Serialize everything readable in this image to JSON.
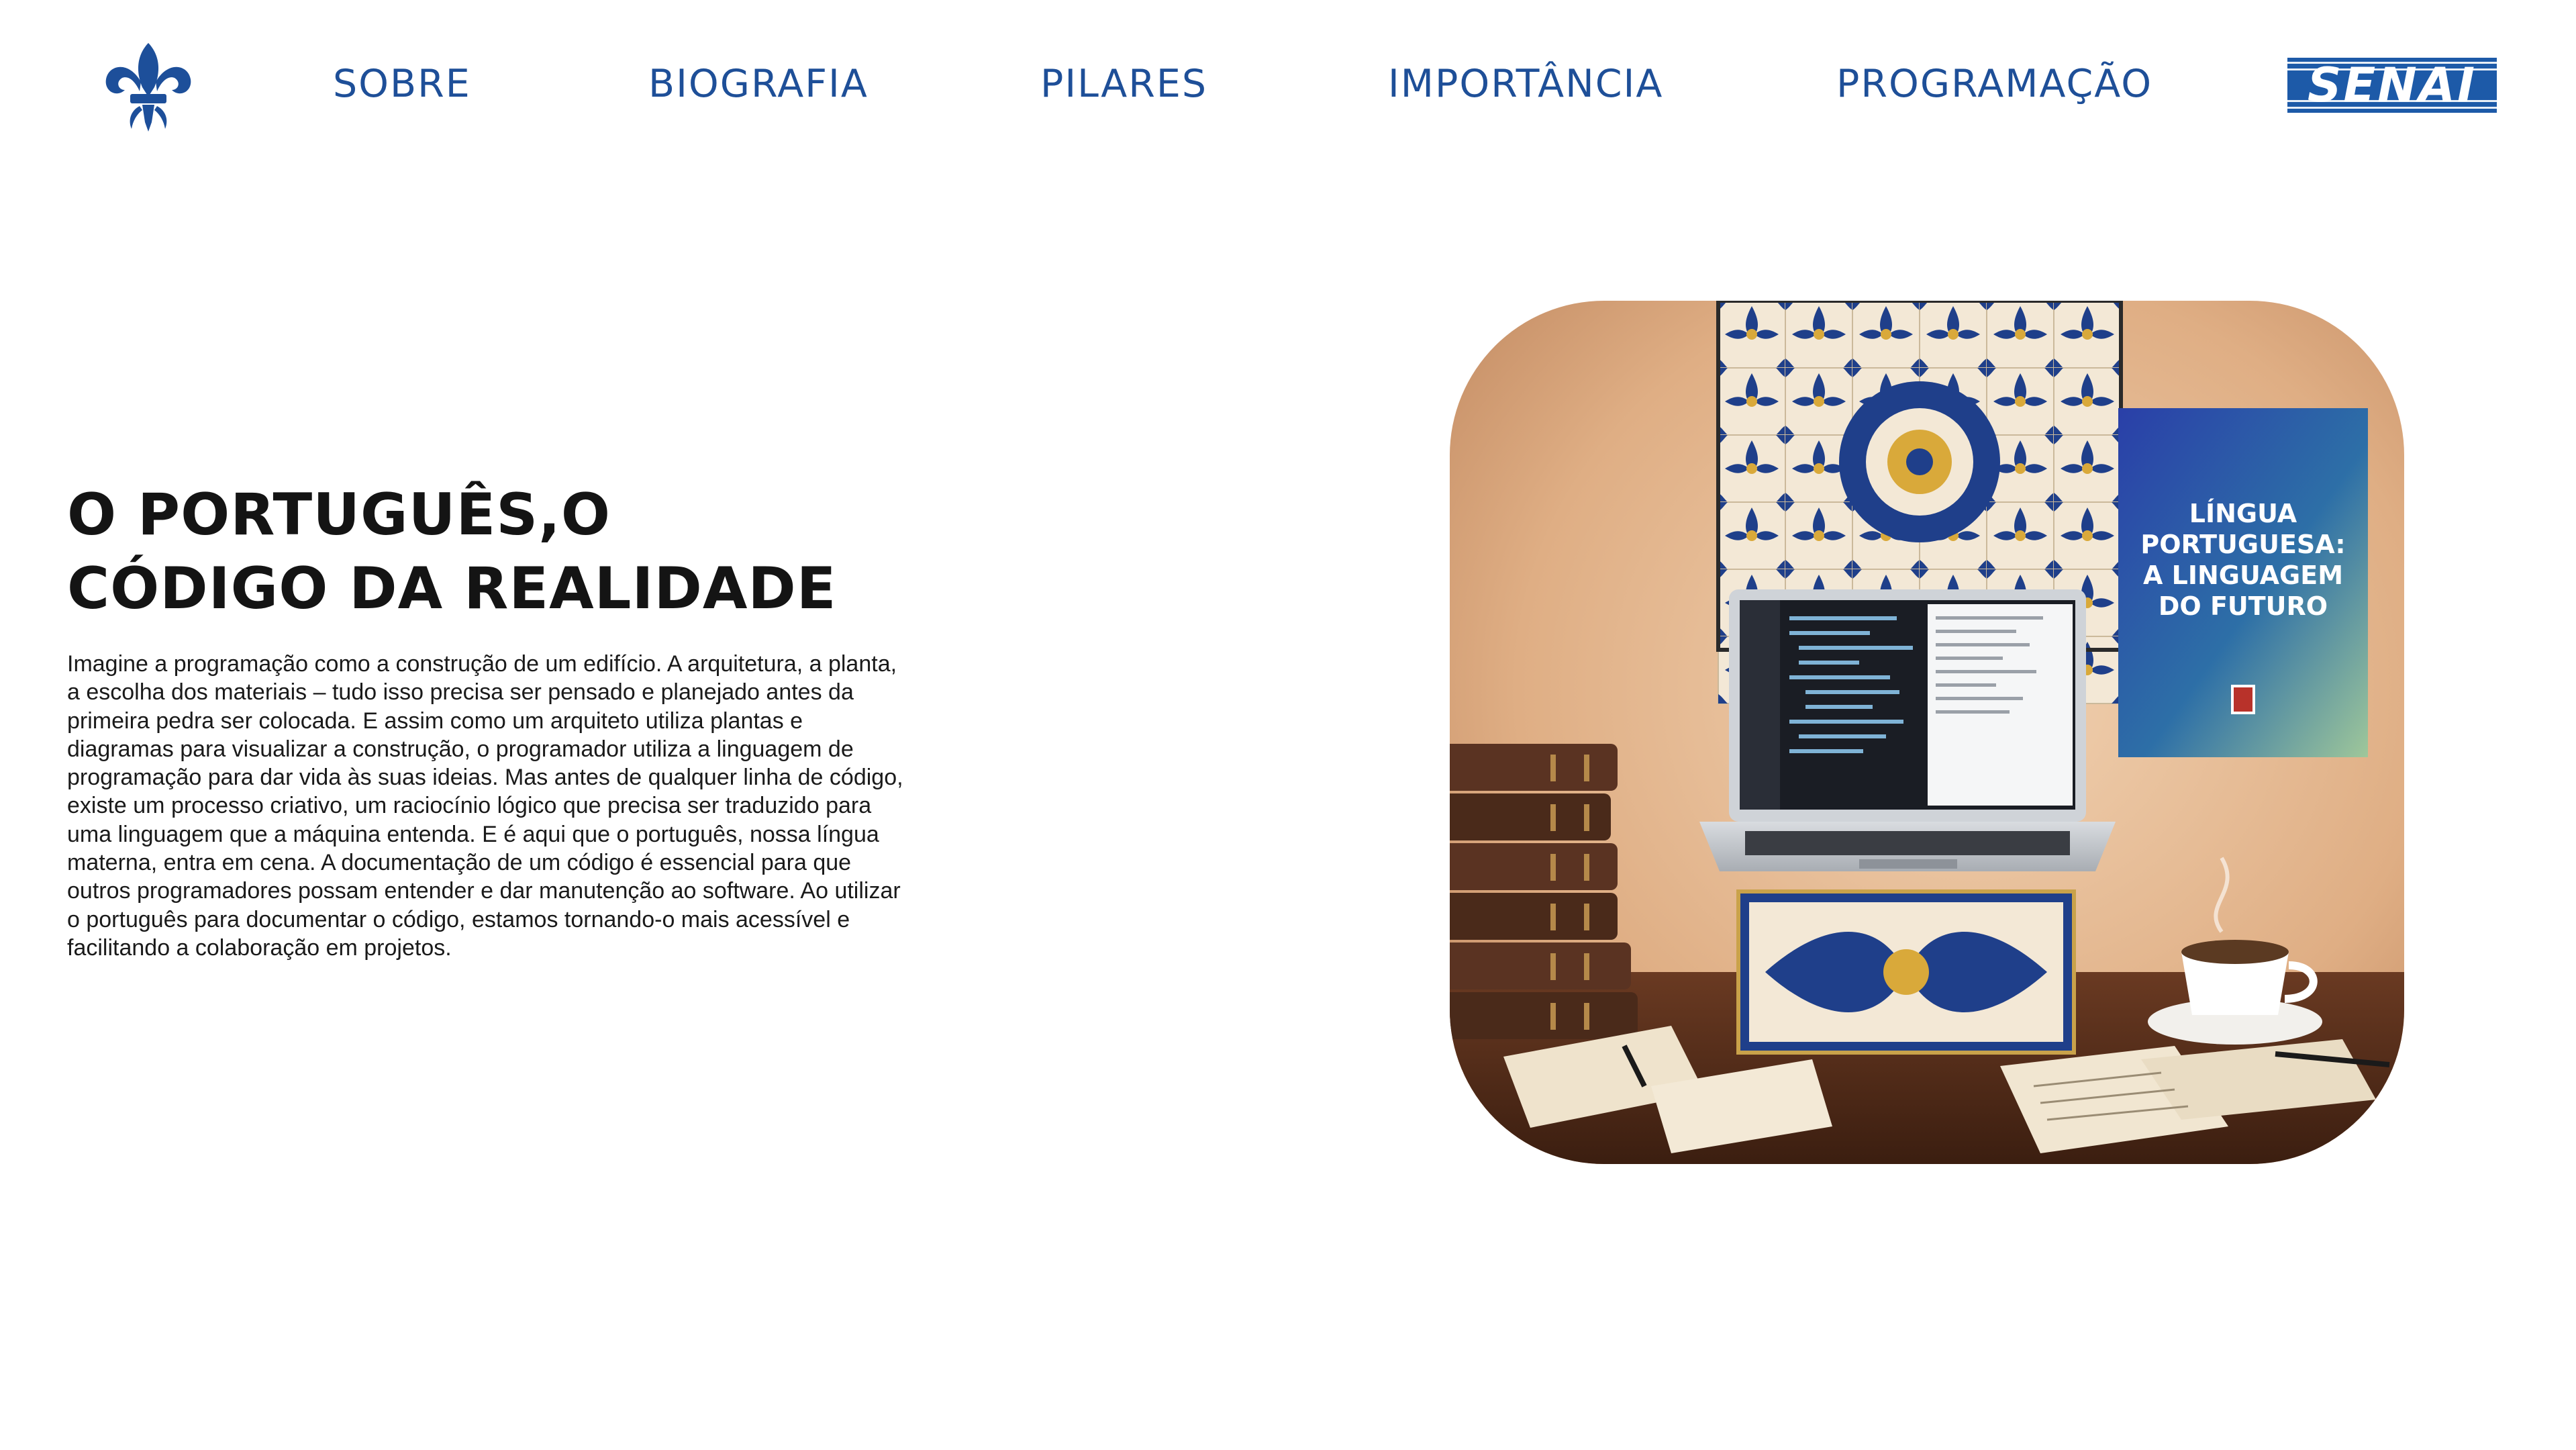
{
  "nav": {
    "items": [
      {
        "label": "SOBRE"
      },
      {
        "label": "BIOGRAFIA"
      },
      {
        "label": "PILARES"
      },
      {
        "label": "IMPORTÂNCIA"
      },
      {
        "label": "PROGRAMAÇÃO"
      }
    ],
    "partner_logo_text": "SENAI"
  },
  "hero": {
    "title_line1": "O PORTUGUÊS,O",
    "title_line2": "CÓDIGO DA REALIDADE",
    "body": "Imagine a programação como a construção de um edifício. A arquitetura, a planta, a escolha dos materiais – tudo isso precisa ser pensado e planejado antes da primeira pedra ser colocada. E assim como um arquiteto utiliza plantas e diagramas para visualizar a construção, o programador utiliza a linguagem de programação para dar vida às suas ideias. Mas antes de qualquer linha de código, existe um processo criativo, um raciocínio lógico que precisa ser traduzido para uma linguagem que a máquina entenda. E é aqui que o português, nossa língua materna, entra em cena. A documentação de um código é essencial para que outros programadores possam entender e dar manutenção ao software. Ao utilizar o português para documentar o código, estamos tornando-o mais acessível e facilitando a colaboração em projetos.",
    "poster_lines": [
      "LÍNGUA",
      "PORTUGUESA:",
      "A LINGUAGEM",
      "DO FUTURO"
    ]
  },
  "colors": {
    "nav_text": "#1e4f98",
    "senai_blue": "#1d5aa8",
    "title": "#141414",
    "tile_blue": "#1f3f8a",
    "tile_gold": "#d9a93a"
  },
  "icons": {
    "logo": "fleur-de-lis-icon"
  }
}
